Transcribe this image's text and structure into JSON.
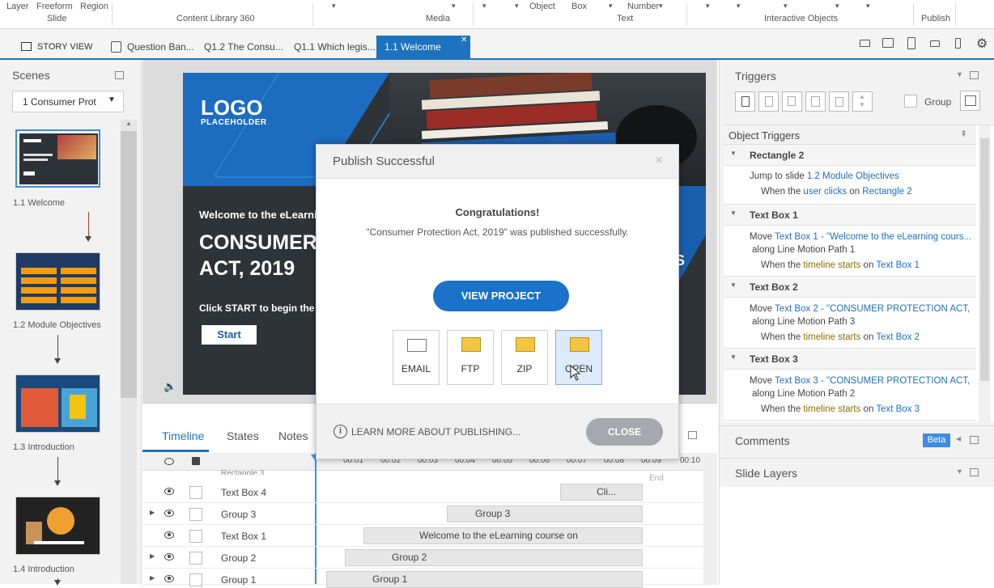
{
  "ribbon": {
    "layer": "Layer",
    "freeform": "Freeform",
    "region": "Region",
    "slide": "Slide",
    "content_library": "Content Library 360",
    "media": "Media",
    "object": "Object",
    "box": "Box",
    "number": "Number",
    "text": "Text",
    "interactive_objects": "Interactive Objects",
    "publish": "Publish"
  },
  "tabs": {
    "story_view": "STORY VIEW",
    "items": [
      "Question Ban...",
      "Q1.2 The Consu...",
      "Q1.1 Which legis...",
      "1.1 Welcome"
    ]
  },
  "scenes": {
    "title": "Scenes",
    "selected": "1 Consumer Prot",
    "slides": [
      "1.1 Welcome",
      "1.2 Module Objectives",
      "1.3 Introduction",
      "1.4 Introduction"
    ]
  },
  "slide": {
    "logo": "LOGO",
    "logo_sub": "PLACEHOLDER",
    "welcome": "Welcome to the eLearning",
    "title_line1": "CONSUMER P",
    "title_line2": "ACT, 2019",
    "instruction": "Click START to begin the cour",
    "start_button": "Start",
    "side_letter": "S"
  },
  "timeline": {
    "tabs": [
      "Timeline",
      "States",
      "Notes"
    ],
    "ticks": [
      "00:01",
      "00:02",
      "00:03",
      "00:04",
      "00:05",
      "00:06",
      "00:07",
      "00:08",
      "00:09",
      "00:10"
    ],
    "end": "End",
    "rows": [
      {
        "name": "Text Box 4",
        "bar": "Cli..."
      },
      {
        "name": "Group 3",
        "bar": "Group 3"
      },
      {
        "name": "Text Box 1",
        "bar": "Welcome to the eLearning course on"
      },
      {
        "name": "Group 2",
        "bar": "Group 2"
      },
      {
        "name": "Group 1",
        "bar": "Group 1"
      }
    ],
    "partial_row": "Rectangle 3"
  },
  "triggers": {
    "title": "Triggers",
    "group_label": "Group",
    "object_triggers": "Object Triggers",
    "items": [
      {
        "header": "Rectangle 2",
        "pre1": "Jump to slide ",
        "link1": "1.2 Module Objectives",
        "pre2": "When the ",
        "kw2": "user clicks",
        "link2": "Rectangle 2"
      },
      {
        "header": "Text Box 1",
        "pre1": "Move ",
        "link1": "Text Box 1 - \"Welcome to the eLearning cours...",
        "mid": "along Line Motion Path 1",
        "pre2": "When the ",
        "kw2": "timeline starts",
        "on": " on ",
        "link2": "Text Box 1"
      },
      {
        "header": "Text Box 2",
        "pre1": "Move ",
        "link1": "Text Box 2 - \"CONSUMER PROTECTION ACT, 2...",
        "mid": "along Line Motion Path 3",
        "pre2": "When the ",
        "kw2": "timeline starts",
        "on": " on ",
        "link2": "Text Box 2"
      },
      {
        "header": "Text Box 3",
        "pre1": "Move ",
        "link1": "Text Box 3 - \"CONSUMER PROTECTION ACT, 2...",
        "mid": "along Line Motion Path 2",
        "pre2": "When the ",
        "kw2": "timeline starts",
        "on": " on ",
        "link2": "Text Box 3"
      }
    ],
    "user_clicks_on": " on ",
    "comments": "Comments",
    "beta": "Beta",
    "slide_layers": "Slide Layers"
  },
  "dialog": {
    "title": "Publish Successful",
    "congrats": "Congratulations!",
    "message": "\"Consumer Protection Act, 2019\" was published successfully.",
    "view_project": "VIEW PROJECT",
    "options": [
      "EMAIL",
      "FTP",
      "ZIP",
      "OPEN"
    ],
    "learn_more": "LEARN MORE ABOUT PUBLISHING...",
    "close": "CLOSE"
  },
  "colors": {
    "accent": "#1e73be",
    "button_blue": "#1a73c8",
    "close_gray": "#a5a9ad",
    "beta": "#3e8de0"
  }
}
